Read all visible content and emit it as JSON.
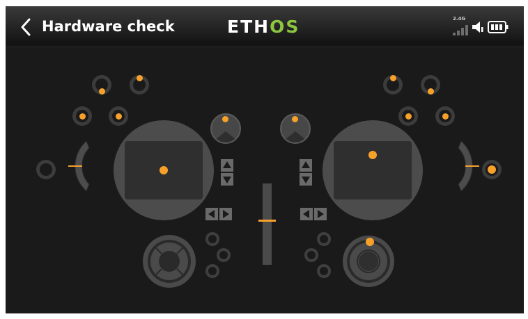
{
  "header": {
    "back_label": "Back",
    "title": "Hardware check",
    "logo_part1": "ETH",
    "logo_part2": "OS",
    "rf_band": "2.4G"
  },
  "colors": {
    "accent": "#f7a12b",
    "logo_green": "#8cc63f",
    "panel": "#4c4c4c",
    "background": "#1a1a1a"
  },
  "controls": {
    "left_stick": {
      "x": 0.0,
      "y": 0.0
    },
    "right_stick": {
      "x": 0.0,
      "y": 0.25
    },
    "left_slider": 0.5,
    "right_slider": 0.5,
    "center_fader": 0.5,
    "left_knob": 0.5,
    "right_knob": 0.5,
    "battery_bars": 3
  },
  "icons": [
    "back-chevron-icon",
    "signal-bars-icon",
    "speaker-icon",
    "battery-icon",
    "trim-up-icon",
    "trim-down-icon",
    "trim-left-icon",
    "trim-right-icon"
  ]
}
